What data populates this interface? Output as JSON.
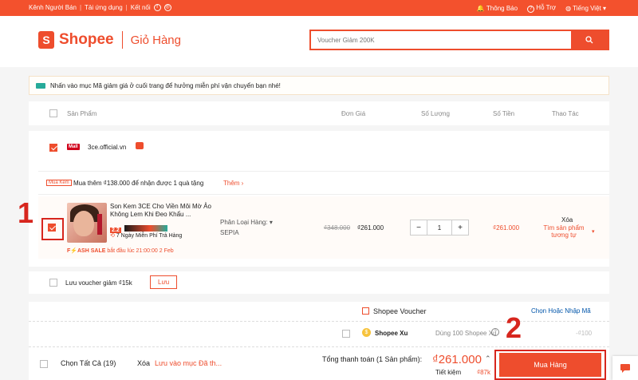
{
  "topbar": {
    "seller": "Kênh Người Bán",
    "download": "Tải ứng dụng",
    "connect": "Kết nối",
    "notify": "Thông Báo",
    "help": "Hỗ Trợ",
    "lang": "Tiếng Việt"
  },
  "header": {
    "brand": "Shopee",
    "page": "Giỏ Hàng",
    "search_placeholder": "Voucher Giảm 200K"
  },
  "notice": "Nhấn vào mục Mã giảm giá ở cuối trang để hưởng miễn phí vận chuyển bạn nhé!",
  "columns": {
    "product": "Sản Phẩm",
    "price": "Đơn Giá",
    "qty": "Số Lượng",
    "total": "Số Tiền",
    "action": "Thao Tác"
  },
  "shop": {
    "badge": "Mall",
    "name": "3ce.official.vn"
  },
  "promo": {
    "badge": "Mua Kèm",
    "text": "Mua thêm ₫138.000 để nhận được 1 quà tặng",
    "link": "Thêm"
  },
  "item": {
    "title": "Son Kem 3CE Cho Viền Môi Mờ Ảo Không Lem Khi Đeo Khẩu ...",
    "tag": "2.2",
    "return_text": "7 Ngày Miễn Phí Trả Hàng",
    "flash": "F⚡ASH SALE",
    "flash_time": "bắt đầu lúc 21:00:00 2 Feb",
    "variant_label": "Phân Loại Hàng:",
    "variant_value": "SEPIA",
    "old_price": "₫348.000",
    "price": "₫261.000",
    "qty": "1",
    "minus": "−",
    "plus": "+",
    "total": "₫261.000",
    "delete": "Xóa",
    "similar": "Tìm sản phẩm tương tự"
  },
  "voucher_row": {
    "text": "Lưu voucher giảm ₫15k",
    "button": "Lưu"
  },
  "bottom": {
    "shopee_voucher": "Shopee Voucher",
    "choose_code": "Chọn Hoặc Nhập Mã",
    "xu_label": "Shopee Xu",
    "xu_use": "Dùng 100 Shopee Xu",
    "xu_value": "-₫100",
    "select_all": "Chọn Tất Cả (19)",
    "delete": "Xóa",
    "save_later": "Lưu vào mục Đã th...",
    "total_label": "Tổng thanh toán (1 Sản phẩm):",
    "total_value": "₫261.000",
    "save_label": "Tiết kiệm",
    "save_value": "₫87k",
    "buy": "Mua Hàng"
  },
  "annotations": {
    "one": "1",
    "two": "2"
  },
  "colors": {
    "brand": "#ee4d2d",
    "annotation": "#d7261e"
  }
}
